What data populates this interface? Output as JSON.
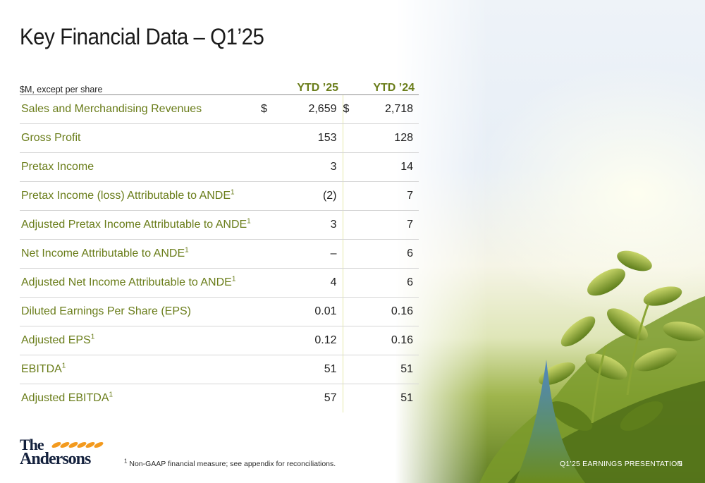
{
  "title": "Key Financial Data – Q1’25",
  "table": {
    "unit_label": "$M, except per share",
    "col1_header": "YTD ’25",
    "col2_header": "YTD ’24",
    "rows": [
      {
        "label": "Sales and Merchandising Revenues",
        "footnote": "",
        "currency": "$",
        "v1": "2,659",
        "v2": "2,718"
      },
      {
        "label": "Gross Profit",
        "footnote": "",
        "currency": "",
        "v1": "153",
        "v2": "128"
      },
      {
        "label": "Pretax Income",
        "footnote": "",
        "currency": "",
        "v1": "3",
        "v2": "14"
      },
      {
        "label": "Pretax Income (loss) Attributable to ANDE",
        "footnote": "1",
        "currency": "",
        "v1": "(2)",
        "v2": "7"
      },
      {
        "label": "Adjusted Pretax Income Attributable to ANDE",
        "footnote": "1",
        "currency": "",
        "v1": "3",
        "v2": "7"
      },
      {
        "label": "Net Income Attributable to ANDE",
        "footnote": "1",
        "currency": "",
        "v1": "–",
        "v2": "6"
      },
      {
        "label": "Adjusted Net Income Attributable to ANDE",
        "footnote": "1",
        "currency": "",
        "v1": "4",
        "v2": "6"
      },
      {
        "label": "Diluted Earnings Per Share (EPS)",
        "footnote": "",
        "currency": "",
        "v1": "0.01",
        "v2": "0.16"
      },
      {
        "label": "Adjusted EPS",
        "footnote": "1",
        "currency": "",
        "v1": "0.12",
        "v2": "0.16"
      },
      {
        "label": "EBITDA",
        "footnote": "1",
        "currency": "",
        "v1": "51",
        "v2": "51"
      },
      {
        "label": "Adjusted EBITDA",
        "footnote": "1",
        "currency": "",
        "v1": "57",
        "v2": "51"
      }
    ]
  },
  "footnote": {
    "marker": "1",
    "text": " Non-GAAP financial measure; see appendix for reconciliations."
  },
  "logo": {
    "line1": "The",
    "line2": "Andersons"
  },
  "footer": {
    "label": "Q1’25 EARNINGS PRESENTATION",
    "page": "5"
  },
  "colors": {
    "accent_green": "#6a7d1a",
    "logo_blue": "#14213d",
    "logo_orange": "#f39a1e"
  }
}
